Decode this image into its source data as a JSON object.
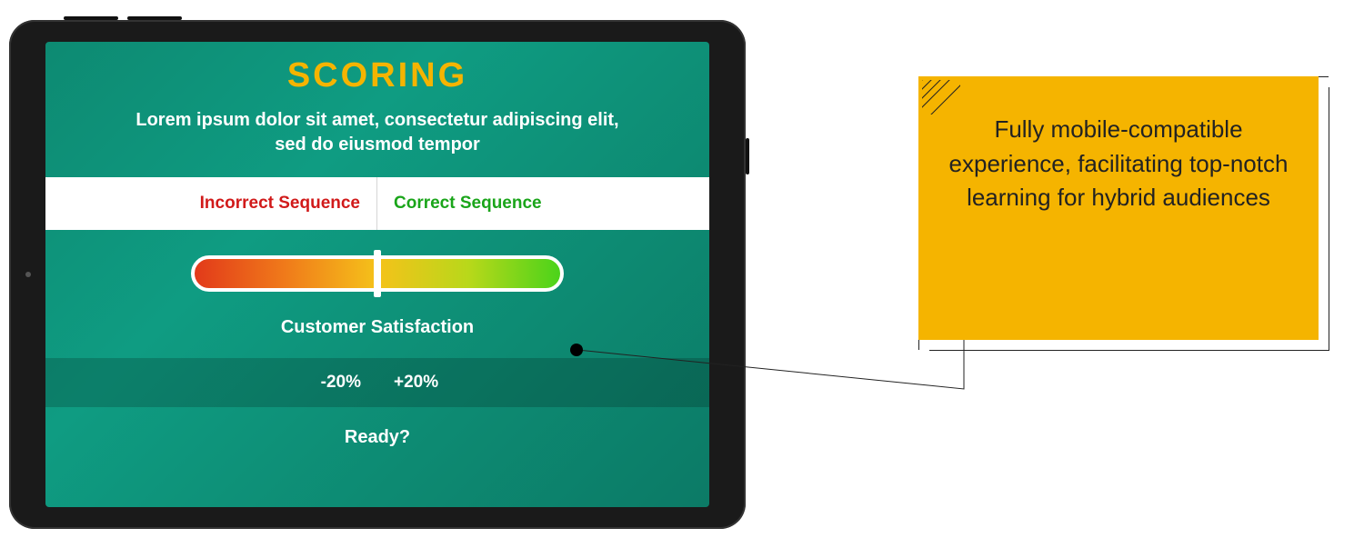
{
  "screen": {
    "title": "SCORING",
    "subtitle": "Lorem ipsum dolor sit amet, consectetur adipiscing elit, sed do eiusmod tempor",
    "sequence": {
      "incorrect_label": "Incorrect Sequence",
      "correct_label": "Correct Sequence"
    },
    "satisfaction_label": "Customer Satisfaction",
    "pct_minus": "-20%",
    "pct_plus": "+20%",
    "ready_label": "Ready?"
  },
  "callout": {
    "text": "Fully mobile-compatible experience, facilitating top-notch learning for hybrid audiences"
  },
  "colors": {
    "accent": "#f5b400",
    "screen_bg": "#0d8a72",
    "incorrect": "#d11a1a",
    "correct": "#1aa51a"
  }
}
